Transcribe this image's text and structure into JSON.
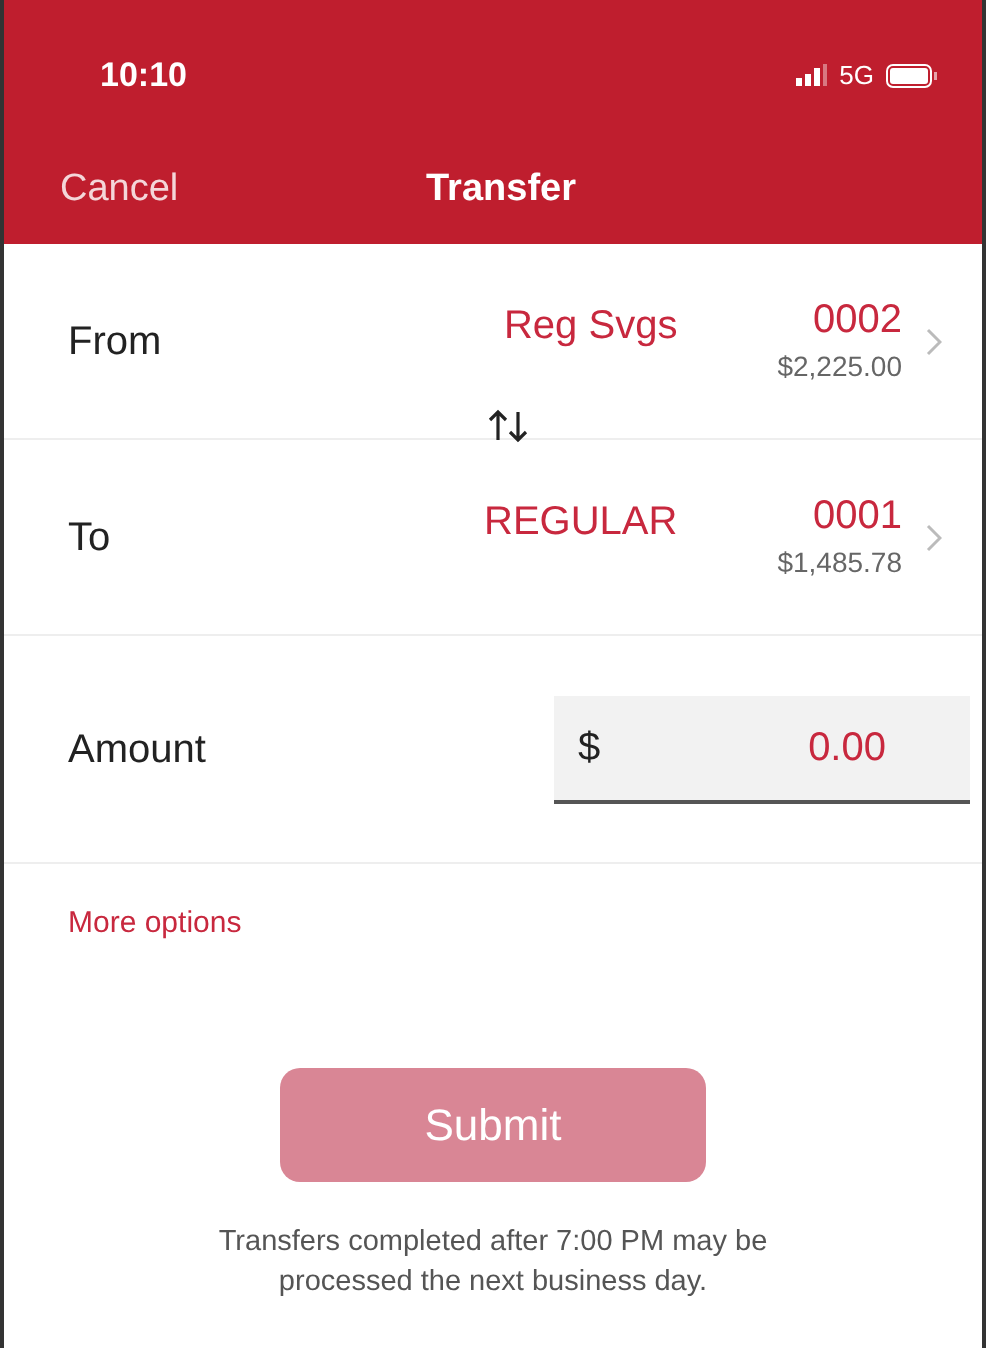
{
  "status_bar": {
    "time": "10:10",
    "network": "5G"
  },
  "nav": {
    "cancel": "Cancel",
    "title": "Transfer"
  },
  "accounts": [
    {
      "label": "From",
      "name": "Reg Svgs",
      "number": "0002",
      "balance": "$2,225.00"
    },
    {
      "label": "To",
      "name": "REGULAR",
      "number": "0001",
      "balance": "$1,485.78"
    }
  ],
  "amount": {
    "label": "Amount",
    "currency": "$",
    "value": "0.00"
  },
  "more_options": "More options",
  "submit": {
    "label": "Submit",
    "disabled": true
  },
  "note": "Transfers completed after 7:00 PM may be processed the next business day."
}
